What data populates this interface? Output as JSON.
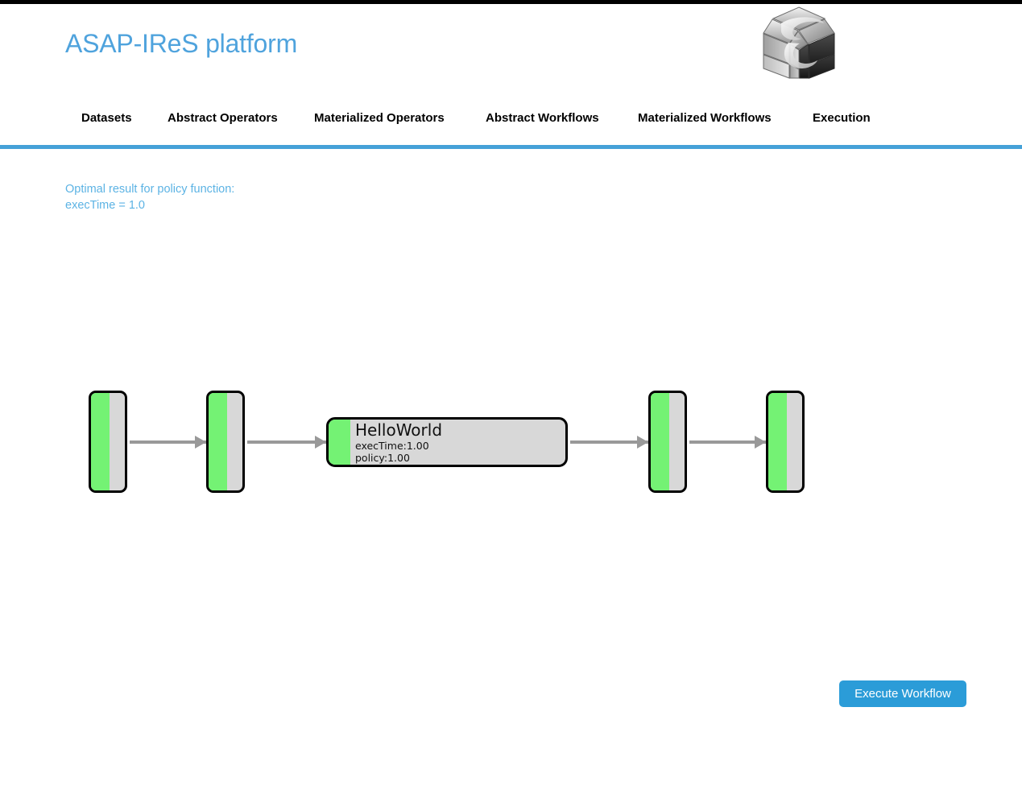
{
  "header": {
    "title": "ASAP-IReS platform",
    "title_color": "#4fa3dd",
    "logo_name": "cube-logo"
  },
  "nav": {
    "items": [
      {
        "label": "Datasets"
      },
      {
        "label": "Abstract Operators"
      },
      {
        "label": "Materialized Operators"
      },
      {
        "label": "Abstract Workflows"
      },
      {
        "label": "Materialized Workflows"
      },
      {
        "label": "Execution"
      }
    ],
    "underline_color": "#45a1d8"
  },
  "result": {
    "line1": "Optimal result for policy function:",
    "line2": "execTime = 1.0",
    "color": "#5cb3e4"
  },
  "workflow": {
    "node_fill": "#d8d8d8",
    "node_band": "#74f274",
    "node_border": "#000000",
    "arrow_color": "#999999",
    "nodes": [
      {
        "id": "node-1",
        "type": "small",
        "label": ""
      },
      {
        "id": "node-2",
        "type": "small",
        "label": ""
      },
      {
        "id": "node-3",
        "type": "operator",
        "title": "HelloWorld",
        "metric1": "execTime:1.00",
        "metric2": "policy:1.00"
      },
      {
        "id": "node-4",
        "type": "small",
        "label": ""
      },
      {
        "id": "node-5",
        "type": "small",
        "label": ""
      }
    ],
    "edges": [
      {
        "from": "node-1",
        "to": "node-2"
      },
      {
        "from": "node-2",
        "to": "node-3"
      },
      {
        "from": "node-3",
        "to": "node-4"
      },
      {
        "from": "node-4",
        "to": "node-5"
      }
    ]
  },
  "actions": {
    "execute_label": "Execute Workflow",
    "execute_color": "#2b9cd8"
  }
}
